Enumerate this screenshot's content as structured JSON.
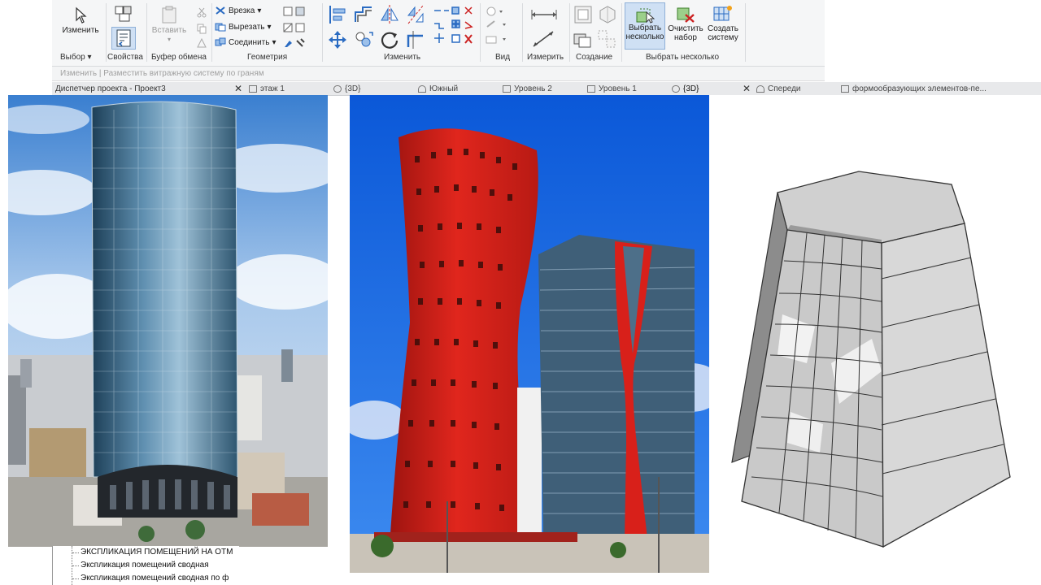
{
  "ribbon": {
    "modify": {
      "label": "Изменить"
    },
    "select_panel": {
      "label": "Выбор"
    },
    "properties": {
      "button": "Свойства"
    },
    "clipboard": {
      "paste": "Вставить",
      "panel": "Буфер обмена"
    },
    "geometry": {
      "cope": "Врезка",
      "cut": "Вырезать",
      "join": "Соединить",
      "panel": "Геометрия"
    },
    "modify_panel": {
      "panel": "Изменить"
    },
    "view_panel": {
      "panel": "Вид"
    },
    "measure_panel": {
      "panel": "Измерить"
    },
    "create_panel": {
      "panel": "Создание"
    },
    "multi_select": {
      "select_multiple": [
        "Выбрать",
        "несколько"
      ],
      "clear_selection": [
        "Очистить",
        "набор"
      ],
      "create_system": [
        "Создать",
        "систему"
      ],
      "panel": "Выбрать несколько"
    }
  },
  "options_bar": {
    "hint": "Изменить | Разместить витражную систему по граням"
  },
  "project_browser": {
    "title": "Диспетчер проекта - Проект3"
  },
  "view_tabs": [
    {
      "label": "этаж 1",
      "icon": "floor-plan-icon"
    },
    {
      "label": "{3D}",
      "icon": "3d-view-icon"
    },
    {
      "label": "Южный",
      "icon": "elevation-icon"
    },
    {
      "label": "Уровень 2",
      "icon": "floor-plan-icon"
    },
    {
      "label": "Уровень 1",
      "icon": "floor-plan-icon"
    },
    {
      "label": "{3D}",
      "icon": "3d-view-icon"
    },
    {
      "label": "Спереди",
      "icon": "elevation-icon"
    },
    {
      "label": "формообразующих элементов-пе...",
      "icon": "schedule-icon"
    }
  ],
  "tree": {
    "items": [
      "ЭКСПЛИКАЦИЯ ПОМЕЩЕНИЙ НА ОТМ",
      "Экспликация помещений сводная",
      "Экспликация помещений сводная по ф"
    ]
  },
  "colors": {
    "ribbon_bg": "#f5f6f7",
    "accent_selected": "#cfe0f4",
    "hotel_red": "#d9241c",
    "sky_blue": "#1f6fe0"
  }
}
